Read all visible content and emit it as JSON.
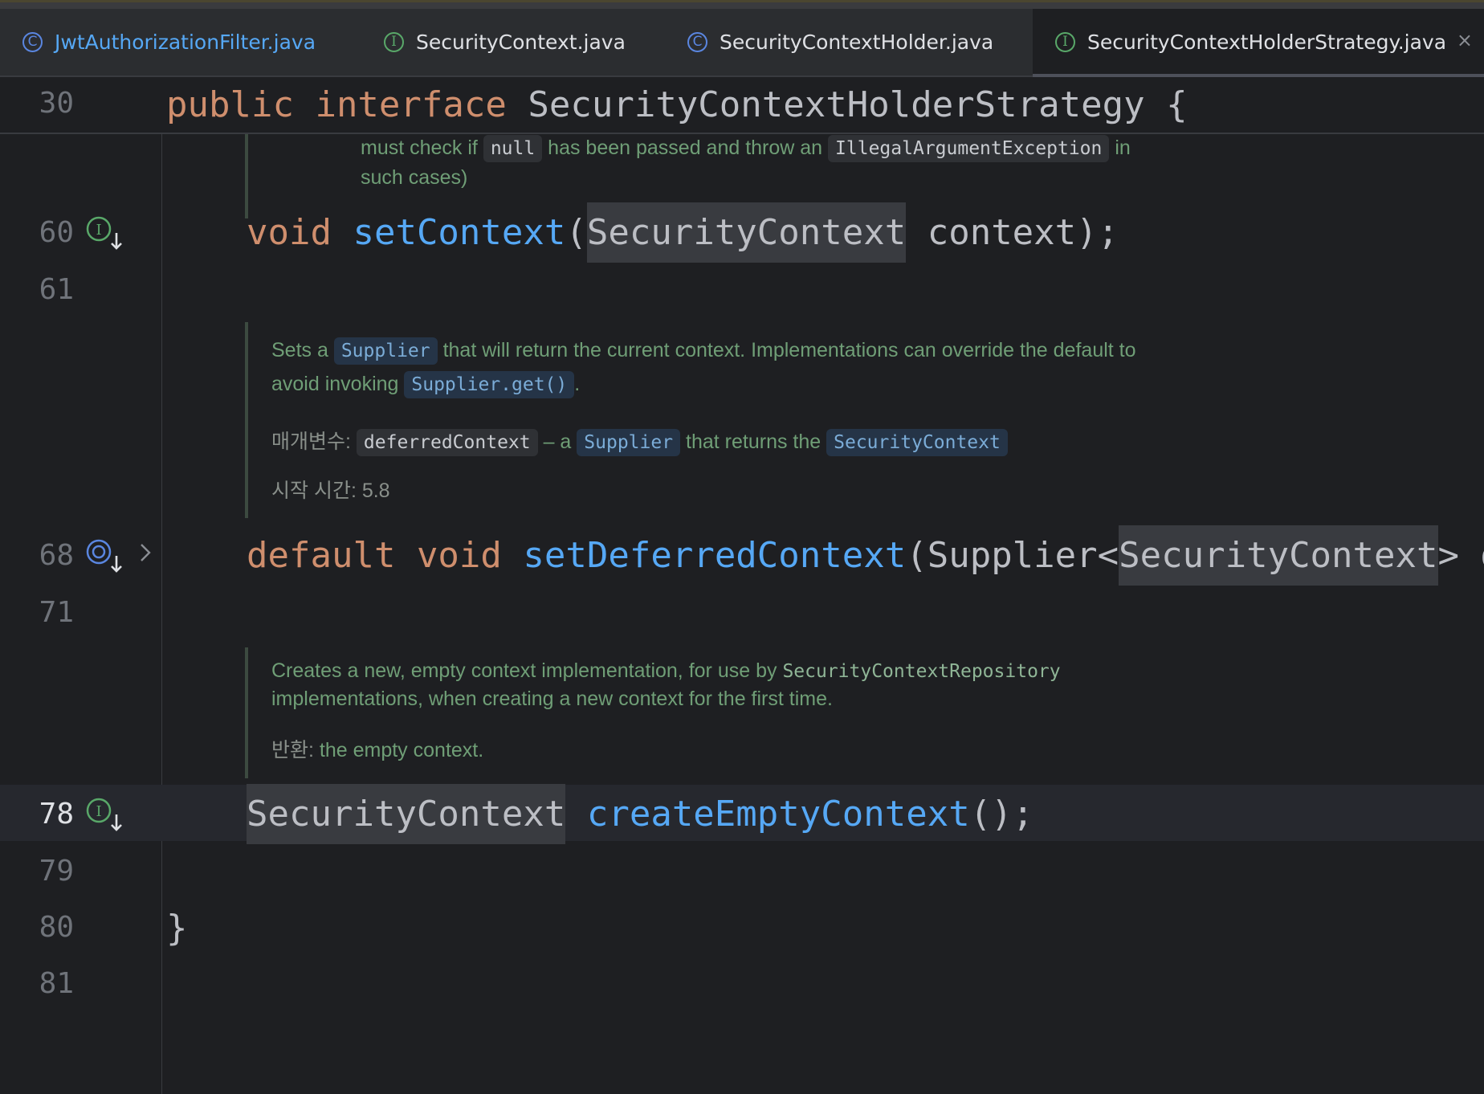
{
  "tabs": [
    {
      "label": "JwtAuthorizationFilter.java",
      "icon": "class-icon",
      "icon_glyph": "C"
    },
    {
      "label": "SecurityContext.java",
      "icon": "interface-icon",
      "icon_glyph": "I"
    },
    {
      "label": "SecurityContextHolder.java",
      "icon": "class-icon",
      "icon_glyph": "C"
    },
    {
      "label": "SecurityContextHolderStrategy.java",
      "icon": "interface-icon",
      "icon_glyph": "I",
      "active": true
    }
  ],
  "close_glyph": "×",
  "sticky": {
    "line": "30",
    "kw1": "public",
    "kw2": "interface",
    "name": "SecurityContextHolderStrategy",
    "brace": "{"
  },
  "doc_top": {
    "line1": {
      "t1": "must check if",
      "c1": "null",
      "t2": "has been passed and throw an",
      "c2": "IllegalArgumentException",
      "t3": "in"
    },
    "line2": "such cases)"
  },
  "lines": {
    "l60": {
      "num": "60",
      "kw": "void",
      "fn": "setContext",
      "open": "(",
      "type": "SecurityContext",
      "rest": " context);"
    },
    "l61": {
      "num": "61"
    },
    "l68": {
      "num": "68",
      "kw1": "default",
      "kw2": "void",
      "fn": "setDeferredContext",
      "open": "(Supplier<",
      "type": "SecurityContext",
      "rest": "> def"
    },
    "l71": {
      "num": "71"
    },
    "l78": {
      "num": "78",
      "type": "SecurityContext",
      "fn": "createEmptyContext",
      "rest": "();"
    },
    "l79": {
      "num": "79"
    },
    "l80": {
      "num": "80",
      "text": "}"
    },
    "l81": {
      "num": "81"
    }
  },
  "doc1": {
    "p1": {
      "t1": "Sets a",
      "c1": "Supplier",
      "t2": "that will return the current context. Implementations can override the default to"
    },
    "p2": {
      "t1": "avoid invoking",
      "c1": "Supplier.get()",
      "t2": "."
    },
    "params": {
      "label": "매개변수:",
      "c1": "deferredContext",
      "t1": "– a",
      "c2": "Supplier",
      "t2": "that returns the",
      "c3": "SecurityContext"
    },
    "since": "시작 시간: 5.8"
  },
  "doc2": {
    "p1": {
      "t1": "Creates a new, empty context implementation, for use by",
      "c1": "SecurityContextRepository"
    },
    "p2": "implementations, when creating a new context for the first time.",
    "returns": {
      "label": "반환:",
      "text": "the empty context."
    }
  },
  "colors": {
    "background": "#1e1f22",
    "keyword": "#cf8e6d",
    "method": "#56a8f5",
    "doc_text": "#6f9e76",
    "interface_icon": "#59a869",
    "class_icon": "#5a86e0"
  }
}
